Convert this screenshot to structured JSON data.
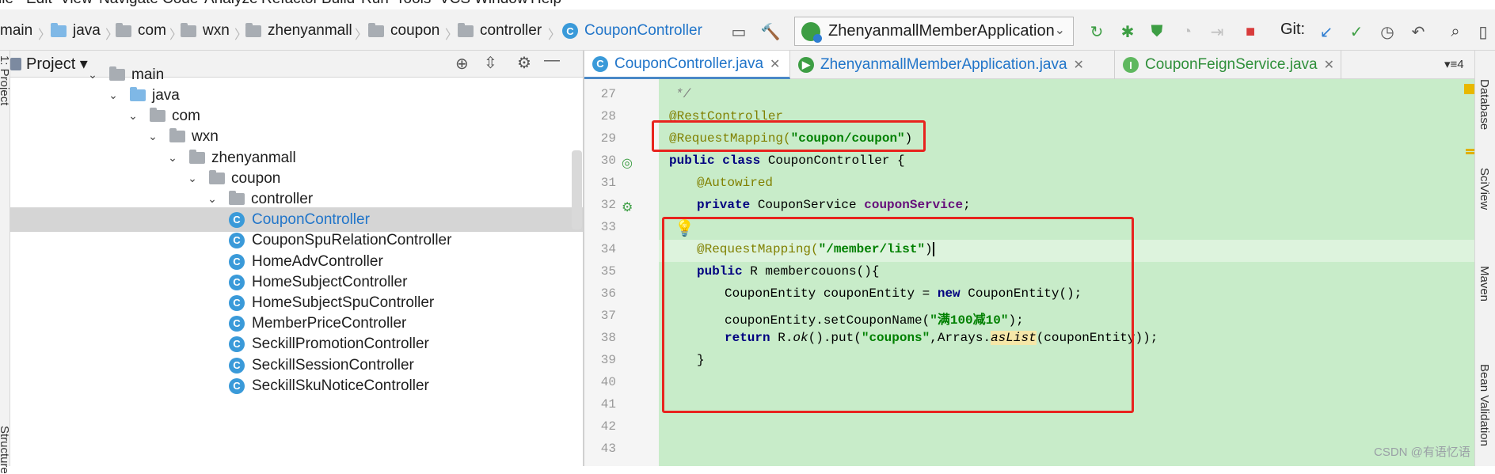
{
  "menu": [
    "ile",
    "Edit",
    "View",
    "Navigate",
    "Code",
    "Analyze",
    "Refactor",
    "Build",
    "Run",
    "Tools",
    "VCS",
    "Window",
    "Help"
  ],
  "breadcrumb": [
    "main",
    "java",
    "com",
    "wxn",
    "zhenyanmall",
    "coupon",
    "controller",
    "CouponController"
  ],
  "run_config": "ZhenyanmallMemberApplication",
  "git_label": "Git:",
  "project_panel": {
    "title": "Project",
    "tree": [
      {
        "label": "main",
        "type": "folder",
        "expanded": true
      },
      {
        "label": "java",
        "type": "source-folder",
        "expanded": true
      },
      {
        "label": "com",
        "type": "package",
        "expanded": true
      },
      {
        "label": "wxn",
        "type": "package",
        "expanded": true
      },
      {
        "label": "zhenyanmall",
        "type": "package",
        "expanded": true
      },
      {
        "label": "coupon",
        "type": "package",
        "expanded": true
      },
      {
        "label": "controller",
        "type": "package",
        "expanded": true
      },
      {
        "label": "CouponController",
        "type": "class",
        "selected": true
      },
      {
        "label": "CouponSpuRelationController",
        "type": "class"
      },
      {
        "label": "HomeAdvController",
        "type": "class"
      },
      {
        "label": "HomeSubjectController",
        "type": "class"
      },
      {
        "label": "HomeSubjectSpuController",
        "type": "class"
      },
      {
        "label": "MemberPriceController",
        "type": "class"
      },
      {
        "label": "SeckillPromotionController",
        "type": "class"
      },
      {
        "label": "SeckillSessionController",
        "type": "class"
      },
      {
        "label": "SeckillSkuNoticeController",
        "type": "class"
      }
    ]
  },
  "tabs": [
    {
      "label": "CouponController.java",
      "active": true
    },
    {
      "label": "ZhenyanmallMemberApplication.java",
      "active": false
    },
    {
      "label": "CouponFeignService.java",
      "active": false
    }
  ],
  "tab_count": "4",
  "line_numbers": [
    "27",
    "28",
    "29",
    "30",
    "31",
    "32",
    "33",
    "34",
    "35",
    "36",
    "37",
    "38",
    "39",
    "40",
    "41",
    "42",
    "43"
  ],
  "code": {
    "l27": "*/",
    "l28": "@RestController",
    "l29_ann": "@RequestMapping(",
    "l29_str": "\"coupon/coupon\"",
    "l29_end": ")",
    "l30_a": "public class ",
    "l30_b": "CouponController {",
    "l31": "@Autowired",
    "l32_a": "private ",
    "l32_b": "CouponService ",
    "l32_c": "couponService",
    "l32_d": ";",
    "l34_ann": "@RequestMapping(",
    "l34_str": "\"/member/list\"",
    "l34_end": ")",
    "l35_a": "public ",
    "l35_b": "R membercouons(){",
    "l36_a": "CouponEntity couponEntity = ",
    "l36_b": "new ",
    "l36_c": "CouponEntity();",
    "l37_a": "couponEntity.setCouponName(",
    "l37_b": "\"满100减10\"",
    "l37_c": ");",
    "l38_a": "return ",
    "l38_b": "R.",
    "l38_c": "ok",
    "l38_d": "().put(",
    "l38_e": "\"coupons\"",
    "l38_f": ",Arrays.",
    "l38_g": "asList",
    "l38_h": "(couponEntity));",
    "l39": "}"
  },
  "right_tools": [
    "Database",
    "SciView",
    "Maven",
    "Bean Validation"
  ],
  "left_tools": [
    "1: Project",
    "Structure"
  ],
  "watermark": "CSDN @有语忆语",
  "colors": {
    "highlight_box": "#e8231e",
    "code_bg": "#c8ecc9",
    "accent": "#2175c9"
  }
}
